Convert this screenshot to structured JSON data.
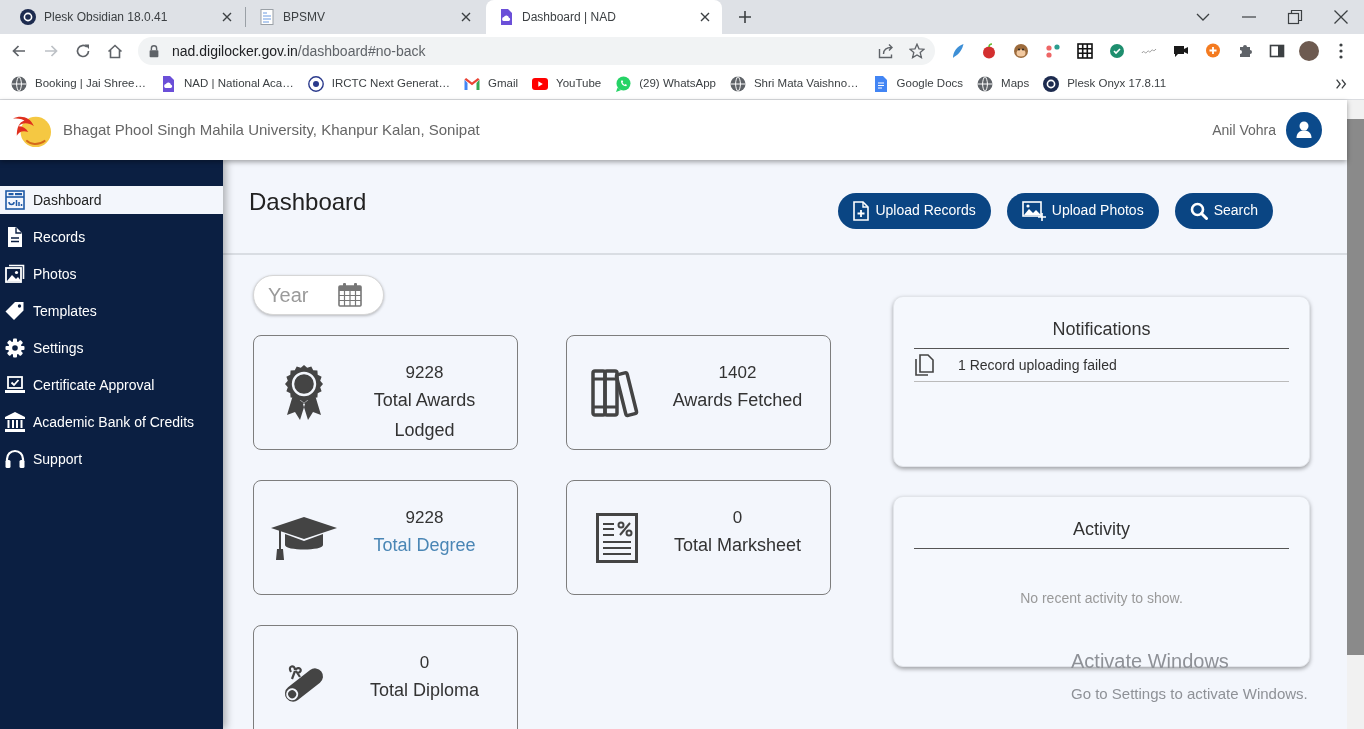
{
  "browser": {
    "tabs": [
      {
        "kind": "plesk",
        "title": "Plesk Obsidian 18.0.41",
        "selected": false
      },
      {
        "kind": "page",
        "title": "BPSMV",
        "selected": false
      },
      {
        "kind": "nad",
        "title": "Dashboard | NAD",
        "selected": true
      }
    ],
    "nav_buttons": [
      {
        "kind": "back",
        "disabled": false
      },
      {
        "kind": "forward",
        "disabled": true
      },
      {
        "kind": "reload",
        "disabled": false
      },
      {
        "kind": "home",
        "disabled": false
      }
    ],
    "address": {
      "domain": "nad.digilocker.gov.in",
      "path": "/dashboard#no-back"
    },
    "bookmarks": [
      {
        "kind": "globe",
        "label": "Booking | Jai Shree…"
      },
      {
        "kind": "nad",
        "label": "NAD | National Aca…"
      },
      {
        "kind": "irctc",
        "label": "IRCTC Next Generat…"
      },
      {
        "kind": "gmail",
        "label": "Gmail"
      },
      {
        "kind": "youtube",
        "label": "YouTube"
      },
      {
        "kind": "whatsapp",
        "label": "(29) WhatsApp"
      },
      {
        "kind": "globe",
        "label": "Shri Mata Vaishno…"
      },
      {
        "kind": "docs",
        "label": "Google Docs"
      },
      {
        "kind": "globe",
        "label": "Maps"
      },
      {
        "kind": "plesk",
        "label": "Plesk Onyx 17.8.11"
      }
    ]
  },
  "header": {
    "title": "Bhagat Phool Singh Mahila University, Khanpur Kalan, Sonipat",
    "user": "Anil Vohra"
  },
  "sidebar": {
    "items": [
      {
        "kind": "dashboard",
        "label": "Dashboard",
        "selected": true
      },
      {
        "kind": "records",
        "label": "Records",
        "selected": false
      },
      {
        "kind": "photos",
        "label": "Photos",
        "selected": false
      },
      {
        "kind": "templates",
        "label": "Templates",
        "selected": false
      },
      {
        "kind": "settings",
        "label": "Settings",
        "selected": false
      },
      {
        "kind": "approval",
        "label": "Certificate Approval",
        "selected": false
      },
      {
        "kind": "bank",
        "label": "Academic Bank of Credits",
        "selected": false
      },
      {
        "kind": "support",
        "label": "Support",
        "selected": false
      }
    ]
  },
  "page": {
    "title": "Dashboard",
    "buttons": [
      {
        "kind": "records",
        "label": "Upload Records"
      },
      {
        "kind": "photos",
        "label": "Upload Photos"
      },
      {
        "kind": "search",
        "label": "Search"
      }
    ],
    "year_field": {
      "placeholder": "Year"
    },
    "stats": [
      {
        "kind": "award",
        "value": "9228",
        "label": "Total Awards Lodged",
        "link": false
      },
      {
        "kind": "books",
        "value": "1402",
        "label": "Awards Fetched",
        "link": false
      },
      {
        "kind": "degree",
        "value": "9228",
        "label": "Total Degree",
        "link": true
      },
      {
        "kind": "marksheet",
        "value": "0",
        "label": "Total Marksheet",
        "link": false
      },
      {
        "kind": "diploma",
        "value": "0",
        "label": "Total Diploma",
        "link": false
      }
    ],
    "notifications": {
      "title": "Notifications",
      "items": [
        "1 Record uploading failed"
      ]
    },
    "activity": {
      "title": "Activity",
      "empty_text": "No recent activity to show."
    }
  },
  "os_notice": {
    "title": "Activate Windows",
    "text": "Go to Settings to activate Windows."
  }
}
